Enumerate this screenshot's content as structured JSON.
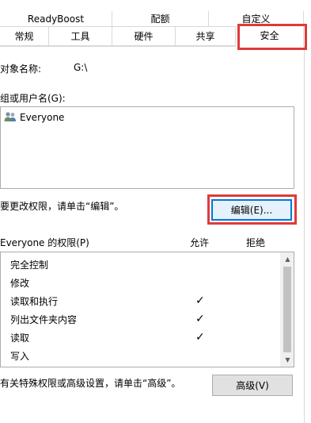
{
  "tabs_row1": [
    {
      "label": "ReadyBoost"
    },
    {
      "label": "配额"
    },
    {
      "label": "自定义"
    }
  ],
  "tabs_row2": [
    {
      "label": "常规"
    },
    {
      "label": "工具"
    },
    {
      "label": "硬件"
    },
    {
      "label": "共享"
    },
    {
      "label": "安全"
    }
  ],
  "object_name": {
    "label": "对象名称:",
    "value": "G:\\"
  },
  "groups": {
    "label": "组或用户名(G):",
    "items": [
      {
        "name": "Everyone",
        "icon": "users-icon"
      }
    ]
  },
  "edit": {
    "hint": "要更改权限，请单击“编辑”。",
    "button_label": "编辑(E)..."
  },
  "permissions": {
    "header": "Everyone 的权限(P)",
    "allow_label": "允许",
    "deny_label": "拒绝",
    "rows": [
      {
        "name": "完全控制",
        "allow": false,
        "deny": false
      },
      {
        "name": "修改",
        "allow": false,
        "deny": false
      },
      {
        "name": "读取和执行",
        "allow": true,
        "deny": false
      },
      {
        "name": "列出文件夹内容",
        "allow": true,
        "deny": false
      },
      {
        "name": "读取",
        "allow": true,
        "deny": false
      },
      {
        "name": "写入",
        "allow": false,
        "deny": false
      }
    ],
    "check_glyph": "✓"
  },
  "advanced": {
    "hint": "有关特殊权限或高级设置，请单击“高级”。",
    "button_label": "高级(V)"
  },
  "colors": {
    "highlight": "#e03a3a",
    "focus": "#0078d7"
  }
}
